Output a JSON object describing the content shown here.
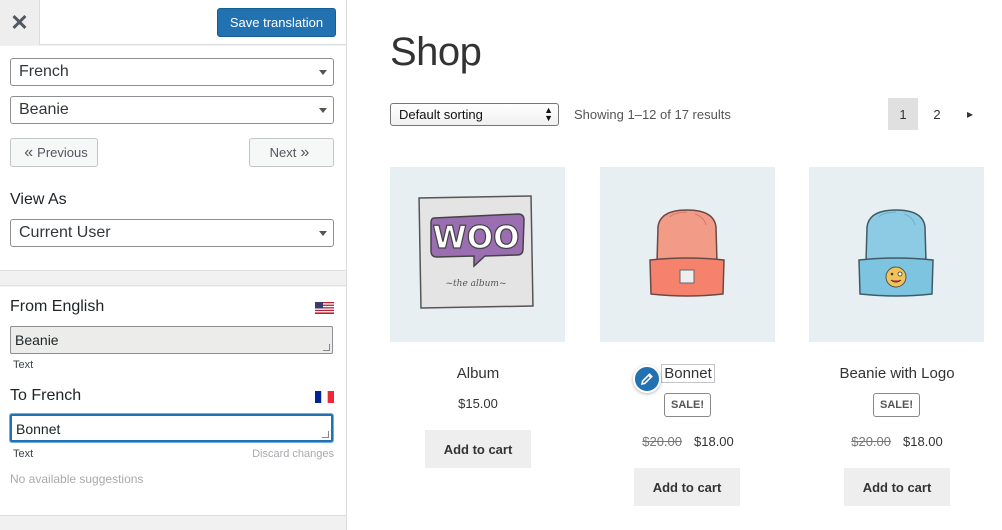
{
  "panel": {
    "close_icon_glyph": "✕",
    "save_label": "Save translation",
    "language_select": "French",
    "string_select": "Beanie",
    "previous_label": "Previous",
    "previous_arrow": "«",
    "next_label": "Next",
    "next_arrow": "»",
    "view_as_label": "View As",
    "view_as_select": "Current User",
    "from_label": "From English",
    "source_text": "Beanie",
    "source_type": "Text",
    "to_label": "To French",
    "target_text": "Bonnet",
    "target_type": "Text",
    "discard_label": "Discard changes",
    "suggestions": "No available suggestions",
    "accent_color": "#2271b1"
  },
  "shop": {
    "title": "Shop",
    "sorting": "Default sorting",
    "results": "Showing 1–12 of 17 results",
    "pages": [
      "1",
      "2"
    ],
    "next_page_icon": "▸",
    "products": [
      {
        "name": "Album",
        "price": "$15.00",
        "cart": "Add to cart",
        "image": "woo-album"
      },
      {
        "name": "Bonnet",
        "sale": "SALE!",
        "old_price": "$20.00",
        "price": "$18.00",
        "cart": "Add to cart",
        "image": "orange-beanie"
      },
      {
        "name": "Beanie with Logo",
        "sale": "SALE!",
        "old_price": "$20.00",
        "price": "$18.00",
        "cart": "Add to cart",
        "image": "blue-beanie-logo"
      }
    ],
    "woo_logo_text": "WOO",
    "woo_caption": "~the album~"
  }
}
